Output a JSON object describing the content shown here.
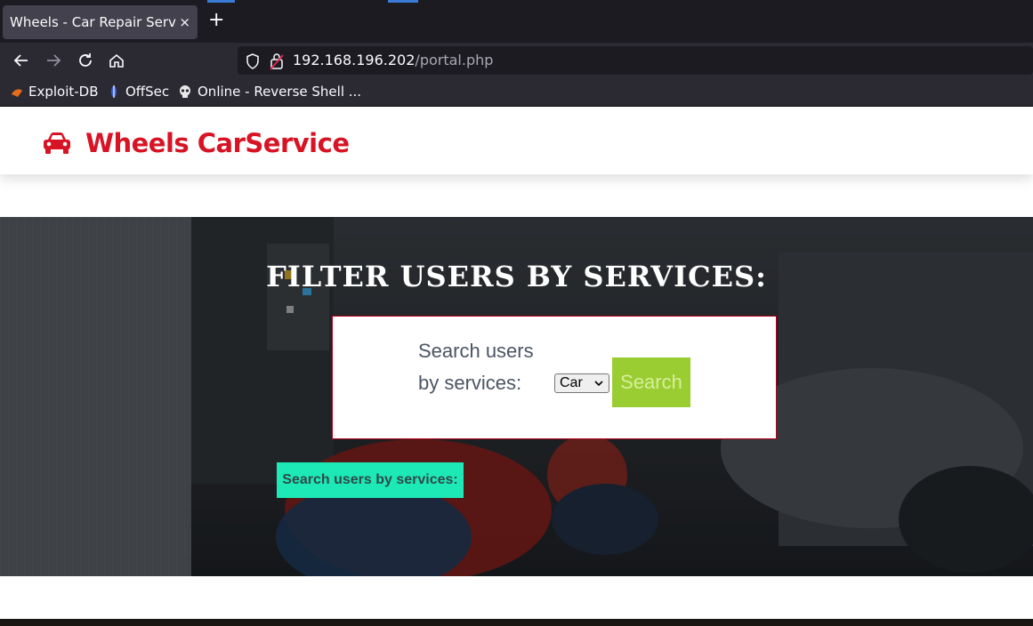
{
  "browser": {
    "tab_title": "Wheels - Car Repair Servic",
    "tab_close": "×",
    "new_tab": "+",
    "url_host": "192.168.196.202",
    "url_path": "/portal.php",
    "bookmarks": [
      {
        "label": "Exploit-DB",
        "icon": "exploit-db-icon"
      },
      {
        "label": "OffSec",
        "icon": "offsec-icon"
      },
      {
        "label": "Online - Reverse Shell ...",
        "icon": "skull-icon"
      }
    ]
  },
  "site": {
    "brand": "Wheels CarService",
    "brand_color": "#d81324"
  },
  "hero": {
    "title": "FILTER USERS BY SERVICES:",
    "form_label": "Search users by services:",
    "select_value": "Car",
    "search_button": "Search",
    "result_badge": "Search users by services:"
  }
}
